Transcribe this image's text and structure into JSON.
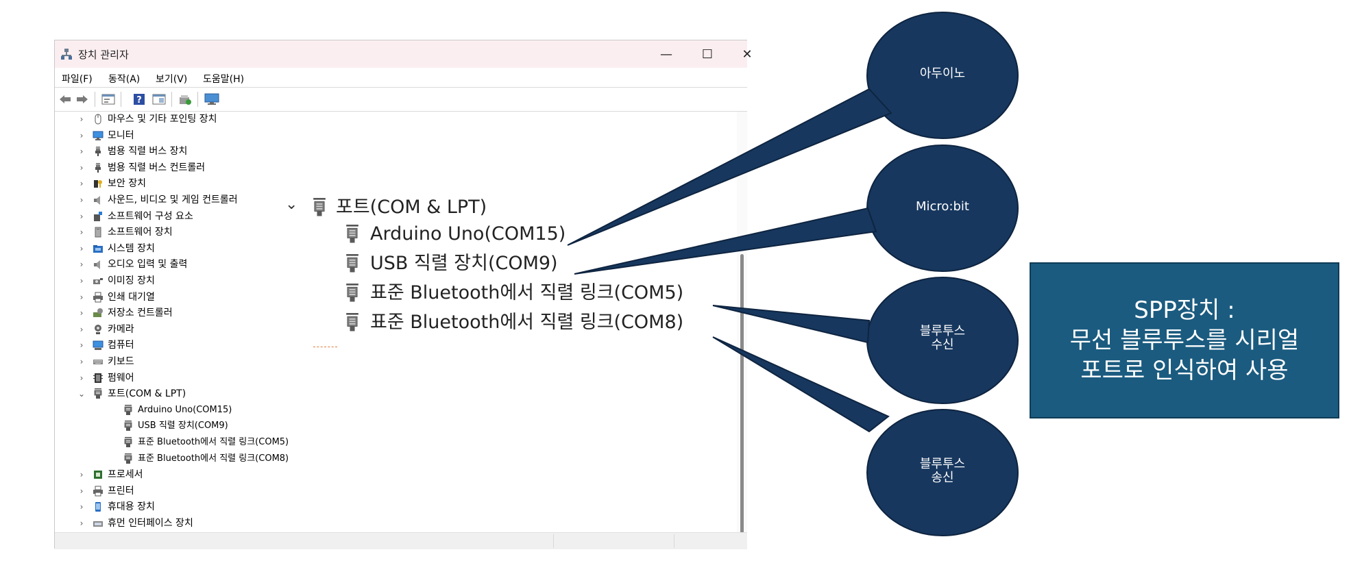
{
  "window": {
    "title": "장치 관리자",
    "min_glyph": "—",
    "max_glyph": "☐",
    "close_glyph": "✕"
  },
  "menu": [
    "파일(F)",
    "동작(A)",
    "보기(V)",
    "도움말(H)"
  ],
  "toolbar_icons": [
    "back-arrow-icon",
    "forward-arrow-icon",
    "properties-icon",
    "help-icon",
    "view-icon",
    "update-driver-icon",
    "monitor-icon"
  ],
  "tree": {
    "items": [
      {
        "label": "마우스 및 기타 포인팅 장치",
        "icon": "mouse-icon"
      },
      {
        "label": "모니터",
        "icon": "monitor-icon"
      },
      {
        "label": "범용 직렬 버스 장치",
        "icon": "usb-plug-icon"
      },
      {
        "label": "범용 직렬 버스 컨트롤러",
        "icon": "usb-plug-icon"
      },
      {
        "label": "보안 장치",
        "icon": "security-key-icon"
      },
      {
        "label": "사운드, 비디오 및 게임 컨트롤러",
        "icon": "speaker-icon"
      },
      {
        "label": "소프트웨어 구성 요소",
        "icon": "software-component-icon"
      },
      {
        "label": "소프트웨어 장치",
        "icon": "software-device-icon"
      },
      {
        "label": "시스템 장치",
        "icon": "system-folder-icon"
      },
      {
        "label": "오디오 입력 및 출력",
        "icon": "speaker-icon"
      },
      {
        "label": "이미징 장치",
        "icon": "camera-icon"
      },
      {
        "label": "인쇄 대기열",
        "icon": "printer-icon"
      },
      {
        "label": "저장소 컨트롤러",
        "icon": "storage-controller-icon"
      },
      {
        "label": "카메라",
        "icon": "webcam-icon"
      },
      {
        "label": "컴퓨터",
        "icon": "computer-icon"
      },
      {
        "label": "키보드",
        "icon": "keyboard-icon"
      },
      {
        "label": "펌웨어",
        "icon": "firmware-chip-icon"
      },
      {
        "label": "포트(COM & LPT)",
        "icon": "port-connector-icon",
        "expanded": true
      },
      {
        "label": "Arduino Uno(COM15)",
        "icon": "port-connector-icon",
        "child": true
      },
      {
        "label": "USB 직렬 장치(COM9)",
        "icon": "port-connector-icon",
        "child": true
      },
      {
        "label": "표준 Bluetooth에서 직렬 링크(COM5)",
        "icon": "port-connector-icon",
        "child": true
      },
      {
        "label": "표준 Bluetooth에서 직렬 링크(COM8)",
        "icon": "port-connector-icon",
        "child": true
      },
      {
        "label": "프로세서",
        "icon": "processor-icon"
      },
      {
        "label": "프린터",
        "icon": "printer-icon"
      },
      {
        "label": "휴대용 장치",
        "icon": "portable-device-icon"
      },
      {
        "label": "휴먼 인터페이스 장치",
        "icon": "hid-icon"
      }
    ]
  },
  "zoom": {
    "header": "포트(COM & LPT)",
    "ports": [
      "Arduino Uno(COM15)",
      "USB 직렬 장치(COM9)",
      "표준 Bluetooth에서 직렬 링크(COM5)",
      "표준 Bluetooth에서 직렬 링크(COM8)"
    ]
  },
  "callouts": {
    "arduino": "아두이노",
    "microbit": "Micro:bit",
    "bt_rx_line1": "블루투스",
    "bt_rx_line2": "수신",
    "bt_tx_line1": "블루투스",
    "bt_tx_line2": "송신"
  },
  "info": {
    "line1": "SPP장치 :",
    "line2": "무선 블루투스를 시리얼",
    "line3": "포트로 인식하여 사용"
  },
  "colors": {
    "bubble_fill": "#17375e",
    "info_fill": "#1b5b7f",
    "titlebar": "#fbeef0"
  }
}
